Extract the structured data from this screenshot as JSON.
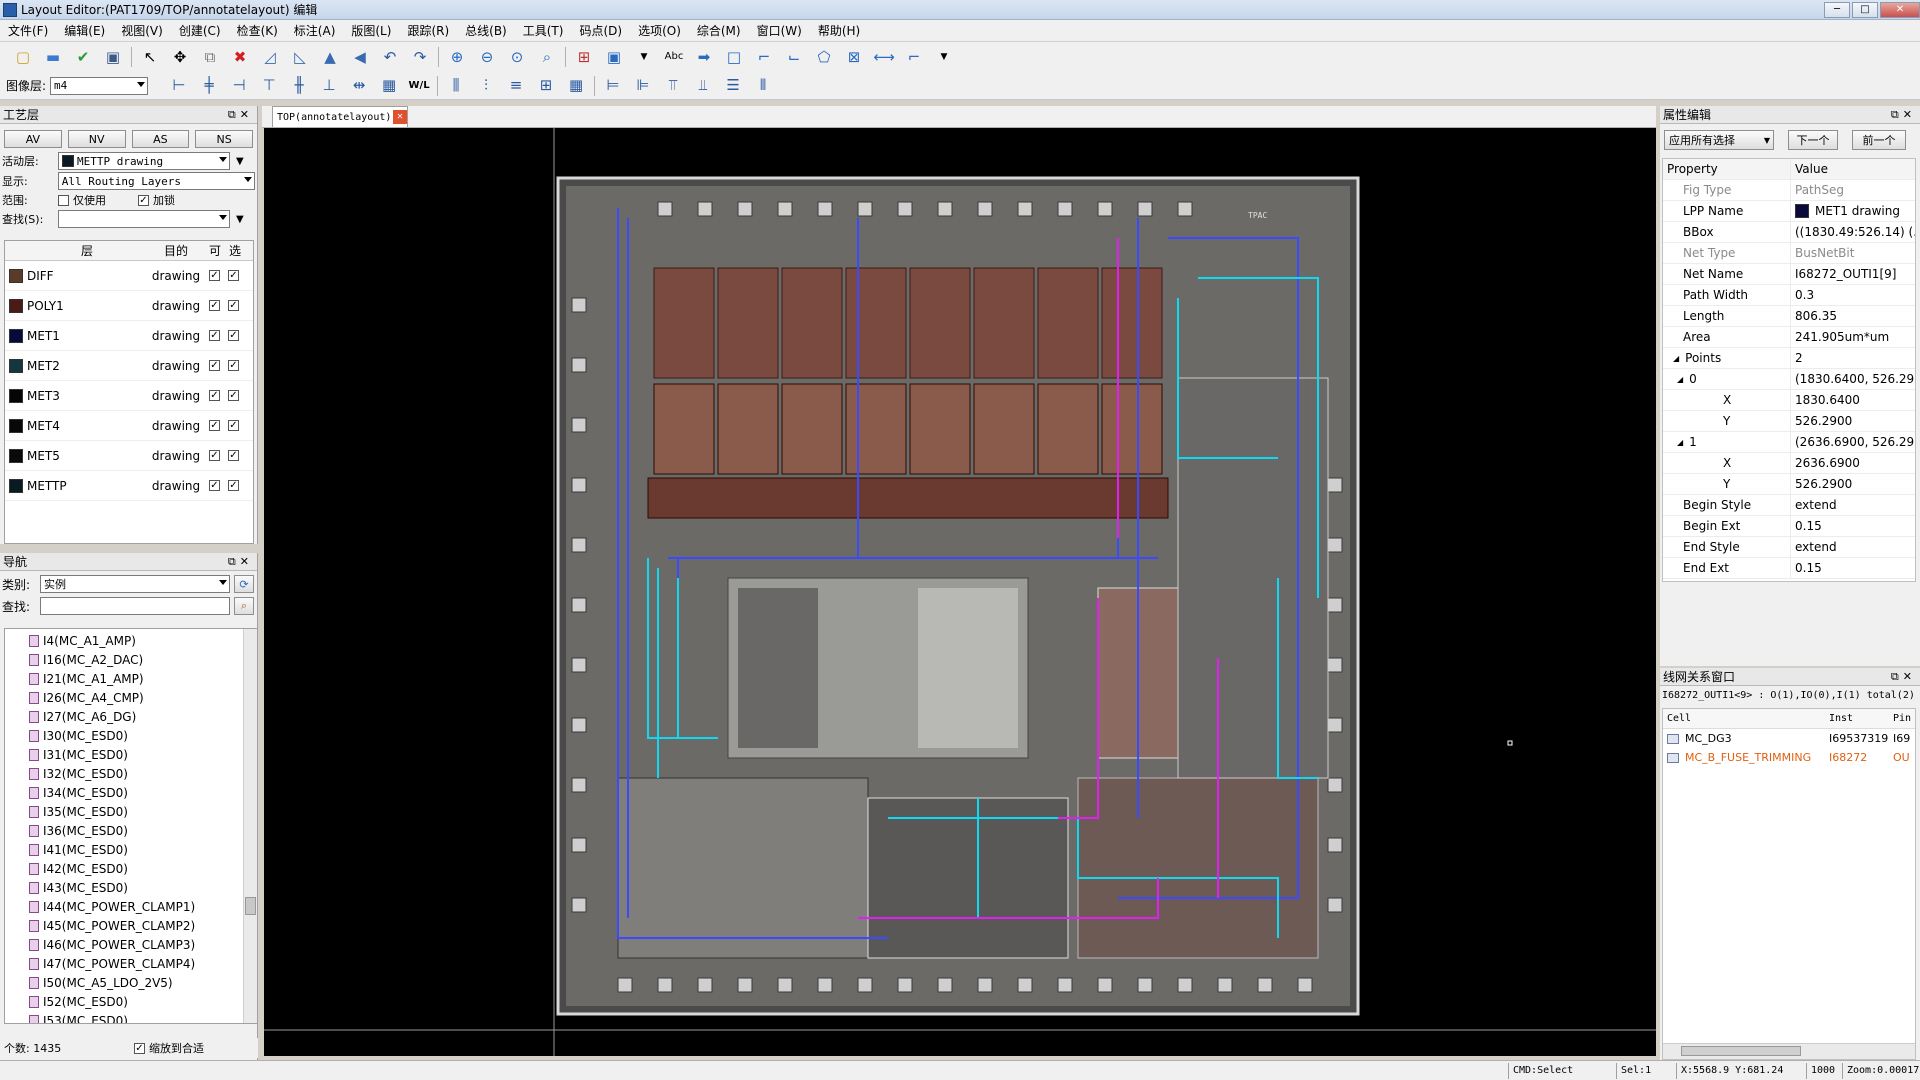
{
  "window": {
    "title": "Layout Editor:(PAT1709/TOP/annotatelayout) 编辑",
    "min": "─",
    "max": "□",
    "close": "✕"
  },
  "menu": [
    "文件(F)",
    "编辑(E)",
    "视图(V)",
    "创建(C)",
    "检查(K)",
    "标注(A)",
    "版图(L)",
    "跟踪(R)",
    "总线(B)",
    "工具(T)",
    "码点(D)",
    "选项(O)",
    "综合(M)",
    "窗口(W)",
    "帮助(H)"
  ],
  "toolbar2": {
    "layer_label": "图像层:",
    "layer_value": "m4",
    "wl_label": "W/L"
  },
  "process_panel": {
    "title": "工艺层",
    "buttons": [
      "AV",
      "NV",
      "AS",
      "NS"
    ],
    "active_layer_label": "活动层:",
    "active_layer_value": "METTP drawing",
    "display_label": "显示:",
    "display_value": "All Routing Layers",
    "scope_label": "范围:",
    "only_use": "仅使用",
    "lock": "加锁",
    "search_label": "查找(S):",
    "headers": {
      "layer": "层",
      "purpose": "目的",
      "vis": "可",
      "sel": "选"
    },
    "layers": [
      {
        "name": "DIFF",
        "purpose": "drawing",
        "color": "#5a3a28"
      },
      {
        "name": "POLY1",
        "purpose": "drawing",
        "color": "#4a1a14"
      },
      {
        "name": "MET1",
        "purpose": "drawing",
        "color": "#0a0a3a"
      },
      {
        "name": "MET2",
        "purpose": "drawing",
        "color": "#16363e"
      },
      {
        "name": "MET3",
        "purpose": "drawing",
        "color": "#050505"
      },
      {
        "name": "MET4",
        "purpose": "drawing",
        "color": "#080808"
      },
      {
        "name": "MET5",
        "purpose": "drawing",
        "color": "#0a0a0a"
      },
      {
        "name": "METTP",
        "purpose": "drawing",
        "color": "#0a1a22"
      }
    ]
  },
  "nav_panel": {
    "title": "导航",
    "category_label": "类别:",
    "category_value": "实例",
    "search_label": "查找:",
    "instances": [
      "I4(MC_A1_AMP)",
      "I16(MC_A2_DAC)",
      "I21(MC_A1_AMP)",
      "I26(MC_A4_CMP)",
      "I27(MC_A6_DG)",
      "I30(MC_ESD0)",
      "I31(MC_ESD0)",
      "I32(MC_ESD0)",
      "I34(MC_ESD0)",
      "I35(MC_ESD0)",
      "I36(MC_ESD0)",
      "I41(MC_ESD0)",
      "I42(MC_ESD0)",
      "I43(MC_ESD0)",
      "I44(MC_POWER_CLAMP1)",
      "I45(MC_POWER_CLAMP2)",
      "I46(MC_POWER_CLAMP3)",
      "I47(MC_POWER_CLAMP4)",
      "I50(MC_A5_LDO_2V5)",
      "I52(MC_ESD0)",
      "I53(MC_ESD0)"
    ],
    "count": "个数: 1435",
    "fit": "缩放到合适"
  },
  "editor_tab": {
    "label": "TOP(annotatelayout)",
    "close": "✕"
  },
  "prop_panel": {
    "title": "属性编辑",
    "apply_all": "应用所有选择",
    "next": "下一个",
    "prev": "前一个",
    "col_property": "Property",
    "col_value": "Value",
    "rows": [
      {
        "k": "Fig Type",
        "v": "PathSeg",
        "indent": 1,
        "dis": true
      },
      {
        "k": "LPP Name",
        "v": "MET1 drawing",
        "indent": 1,
        "swatch": true
      },
      {
        "k": "BBox",
        "v": "((1830.49:526.14) (...",
        "indent": 1
      },
      {
        "k": "Net Type",
        "v": "BusNetBit",
        "indent": 1,
        "dis": true
      },
      {
        "k": "Net Name",
        "v": "I68272_OUTI1[9]",
        "indent": 1
      },
      {
        "k": "Path Width",
        "v": "0.3",
        "indent": 1
      },
      {
        "k": "Length",
        "v": "806.35",
        "indent": 1
      },
      {
        "k": "Area",
        "v": "241.905um*um",
        "indent": 1
      },
      {
        "k": "Points",
        "v": "2",
        "indent": 1,
        "tri": "◢"
      },
      {
        "k": "0",
        "v": "(1830.6400, 526.29...",
        "indent": 2,
        "tri": "◢"
      },
      {
        "k": "X",
        "v": "1830.6400",
        "indent": 4
      },
      {
        "k": "Y",
        "v": "526.2900",
        "indent": 4
      },
      {
        "k": "1",
        "v": "(2636.6900, 526.29...",
        "indent": 2,
        "tri": "◢"
      },
      {
        "k": "X",
        "v": "2636.6900",
        "indent": 4
      },
      {
        "k": "Y",
        "v": "526.2900",
        "indent": 4
      },
      {
        "k": "Begin Style",
        "v": "extend",
        "indent": 1
      },
      {
        "k": "Begin Ext",
        "v": "0.15",
        "indent": 1
      },
      {
        "k": "End Style",
        "v": "extend",
        "indent": 1
      },
      {
        "k": "End Ext",
        "v": "0.15",
        "indent": 1
      }
    ]
  },
  "net_panel": {
    "title": "线网关系窗口",
    "summary": "I68272_OUTI1<9> : O(1),IO(0),I(1) total(2)",
    "col_cell": "Cell",
    "col_inst": "Inst",
    "col_pin": "Pin",
    "rows": [
      {
        "cell": "MC_DG3",
        "inst": "I69537319",
        "pin": "I69",
        "color": "#000000"
      },
      {
        "cell": "MC_B_FUSE_TRIMMING",
        "inst": "I68272",
        "pin": "OU",
        "color": "#e06010"
      }
    ]
  },
  "status": {
    "cmd": "CMD:Select",
    "sel": "Sel:1",
    "xy": "X:5568.9 Y:681.24",
    "grid": "1000",
    "zoom": "Zoom:0.00017"
  }
}
